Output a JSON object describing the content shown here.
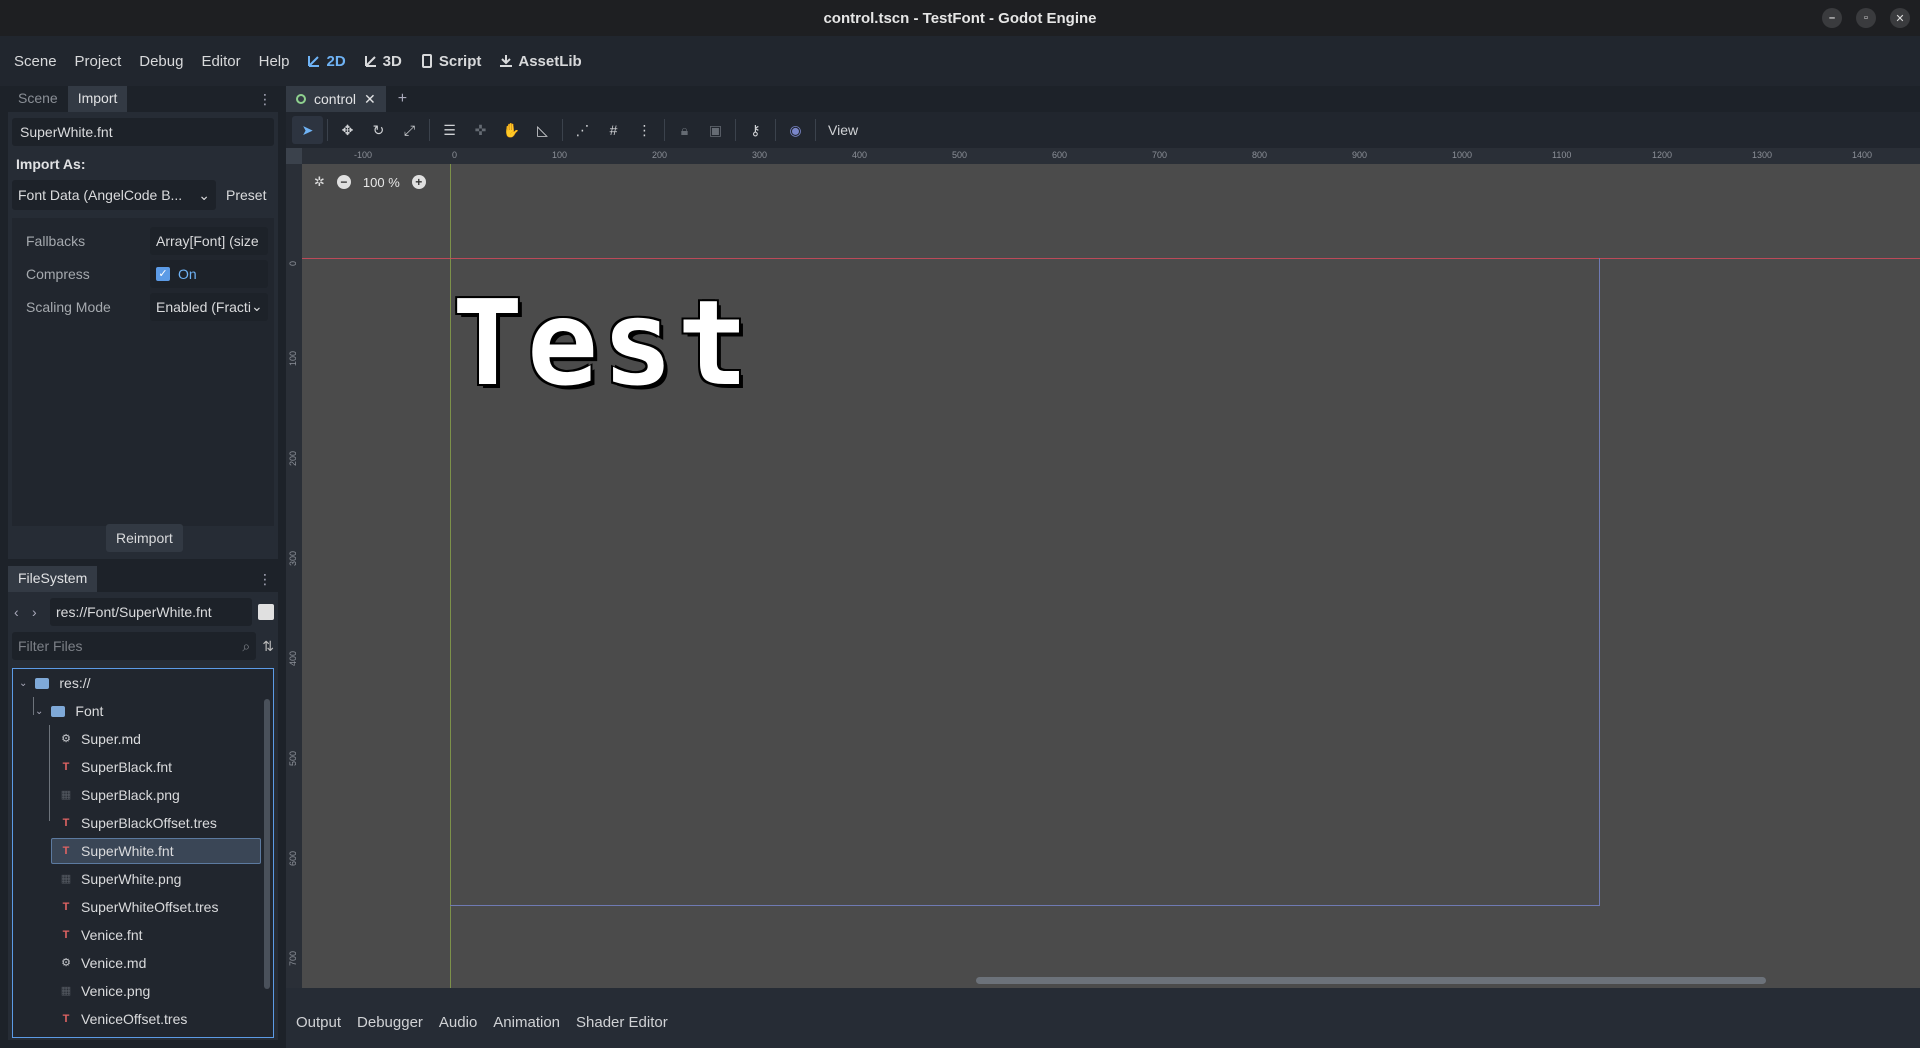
{
  "window": {
    "title": "control.tscn - TestFont - Godot Engine",
    "controls": [
      "–",
      "▫",
      "✕"
    ]
  },
  "menubar": {
    "items": [
      "Scene",
      "Project",
      "Debug",
      "Editor",
      "Help"
    ],
    "modes": [
      {
        "label": "2D",
        "active": true,
        "icon": "2d-icon"
      },
      {
        "label": "3D",
        "active": false,
        "icon": "3d-icon"
      },
      {
        "label": "Script",
        "active": false,
        "icon": "script-icon"
      },
      {
        "label": "AssetLib",
        "active": false,
        "icon": "assetlib-icon"
      }
    ]
  },
  "import_dock": {
    "tabs": [
      "Scene",
      "Import"
    ],
    "active_tab": "Import",
    "file_name": "SuperWhite.fnt",
    "import_as_label": "Import As:",
    "import_as_value": "Font Data (AngelCode B...",
    "preset_label": "Preset",
    "properties": [
      {
        "name": "Fallbacks",
        "value": "Array[Font] (size"
      },
      {
        "name": "Compress",
        "value": "On"
      },
      {
        "name": "Scaling Mode",
        "value": "Enabled (Fracti"
      }
    ],
    "reimport_label": "Reimport"
  },
  "filesystem": {
    "tab": "FileSystem",
    "path": "res://Font/SuperWhite.fnt",
    "filter_placeholder": "Filter Files",
    "root": "res://",
    "folder": "Font",
    "files": [
      {
        "name": "Super.md",
        "type": "md"
      },
      {
        "name": "SuperBlack.fnt",
        "type": "fnt"
      },
      {
        "name": "SuperBlack.png",
        "type": "png"
      },
      {
        "name": "SuperBlackOffset.tres",
        "type": "fnt"
      },
      {
        "name": "SuperWhite.fnt",
        "type": "fnt",
        "selected": true
      },
      {
        "name": "SuperWhite.png",
        "type": "png"
      },
      {
        "name": "SuperWhiteOffset.tres",
        "type": "fnt"
      },
      {
        "name": "Venice.fnt",
        "type": "fnt"
      },
      {
        "name": "Venice.md",
        "type": "md"
      },
      {
        "name": "Venice.png",
        "type": "png"
      },
      {
        "name": "VeniceOffset.tres",
        "type": "fnt"
      }
    ]
  },
  "editor": {
    "scene_tab": "control",
    "view_label": "View",
    "zoom": "100 %",
    "ruler_h": [
      "-100",
      "0",
      "100",
      "200",
      "300",
      "400",
      "500",
      "600",
      "700",
      "800",
      "900",
      "1000",
      "1100",
      "1200",
      "1300",
      "1400"
    ],
    "ruler_v": [
      "0",
      "100",
      "200",
      "300",
      "400",
      "500",
      "600",
      "700"
    ],
    "canvas_text": "Test"
  },
  "bottom_panel": {
    "items": [
      "Output",
      "Debugger",
      "Audio",
      "Animation",
      "Shader Editor"
    ]
  }
}
